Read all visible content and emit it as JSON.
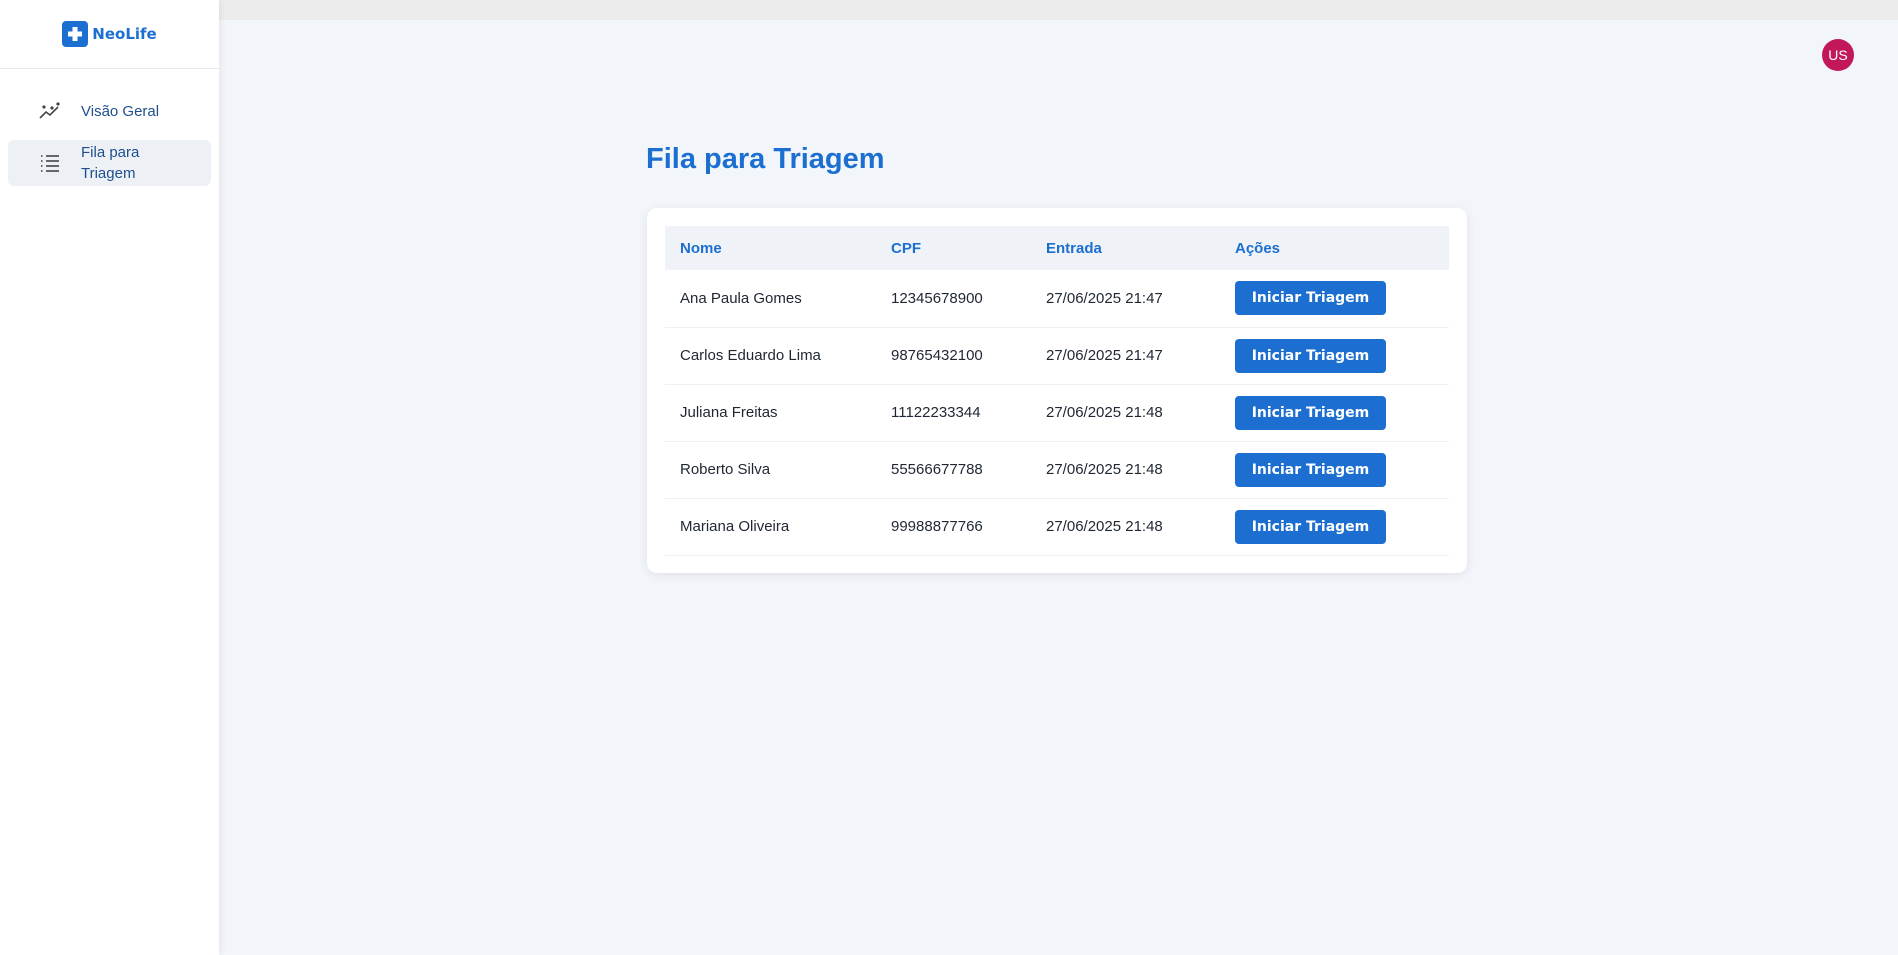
{
  "brand": {
    "name": "NeoLife",
    "logo_icon": "medical-cross-icon",
    "color": "#1c6fd0"
  },
  "sidebar": {
    "items": [
      {
        "label": "Visão Geral",
        "icon": "trending-chart-icon",
        "active": false
      },
      {
        "label": "Fila para Triagem",
        "icon": "list-icon",
        "active": true
      }
    ]
  },
  "user": {
    "initials": "US",
    "avatar_color": "#c2185b"
  },
  "main": {
    "title": "Fila para Triagem",
    "table": {
      "headers": [
        "Nome",
        "CPF",
        "Entrada",
        "Ações"
      ],
      "rows": [
        {
          "nome": "Ana Paula Gomes",
          "cpf": "12345678900",
          "entrada": "27/06/2025 21:47",
          "action": "Iniciar Triagem"
        },
        {
          "nome": "Carlos Eduardo Lima",
          "cpf": "98765432100",
          "entrada": "27/06/2025 21:47",
          "action": "Iniciar Triagem"
        },
        {
          "nome": "Juliana Freitas",
          "cpf": "11122233344",
          "entrada": "27/06/2025 21:48",
          "action": "Iniciar Triagem"
        },
        {
          "nome": "Roberto Silva",
          "cpf": "55566677788",
          "entrada": "27/06/2025 21:48",
          "action": "Iniciar Triagem"
        },
        {
          "nome": "Mariana Oliveira",
          "cpf": "99988877766",
          "entrada": "27/06/2025 21:48",
          "action": "Iniciar Triagem"
        }
      ]
    }
  },
  "colors": {
    "accent": "#1c6fd0",
    "background": "#f2f5f9",
    "nav_text": "#1e4f8c"
  }
}
